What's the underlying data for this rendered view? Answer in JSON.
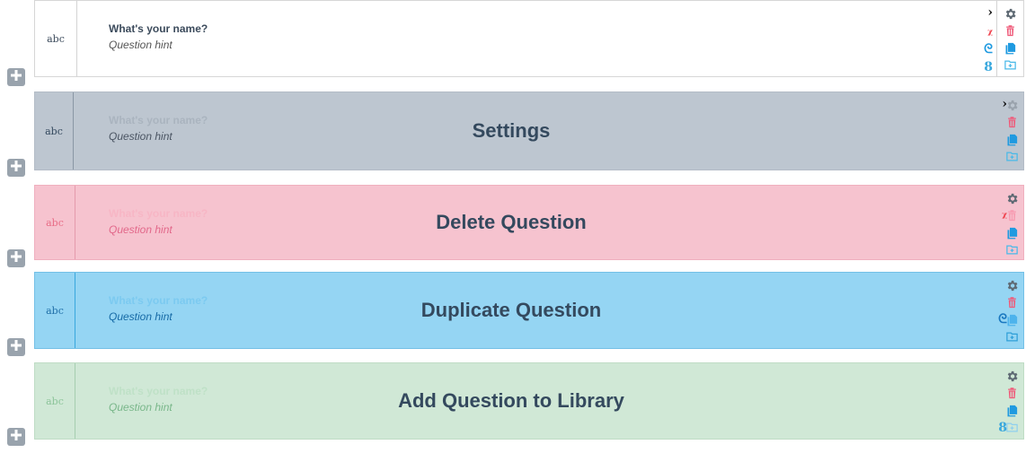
{
  "colors": {
    "gear": "#5f6a74",
    "trash": "#ef5b7a",
    "copy": "#1f9ae0",
    "folder": "#49b9e8",
    "plus_bg": "#99a3ad"
  },
  "rows": [
    {
      "type_label": "abc",
      "title": "What's your name?",
      "hint": "Question hint",
      "caption": ""
    },
    {
      "type_label": "abc",
      "title": "What's your name?",
      "hint": "Question hint",
      "caption": "Settings"
    },
    {
      "type_label": "abc",
      "title": "What's your name?",
      "hint": "Question hint",
      "caption": "Delete Question"
    },
    {
      "type_label": "abc",
      "title": "What's your name?",
      "hint": "Question hint",
      "caption": "Duplicate Question"
    },
    {
      "type_label": "abc",
      "title": "What's your name?",
      "hint": "Question hint",
      "caption": "Add Question to Library"
    }
  ],
  "shortcut_marks": {
    "settings": "›",
    "delete": "ᵪ",
    "duplicate": "ᘓ",
    "library": "8"
  },
  "icons": [
    "gear-icon",
    "trash-icon",
    "copy-icon",
    "folder-plus-icon",
    "plus-icon"
  ]
}
